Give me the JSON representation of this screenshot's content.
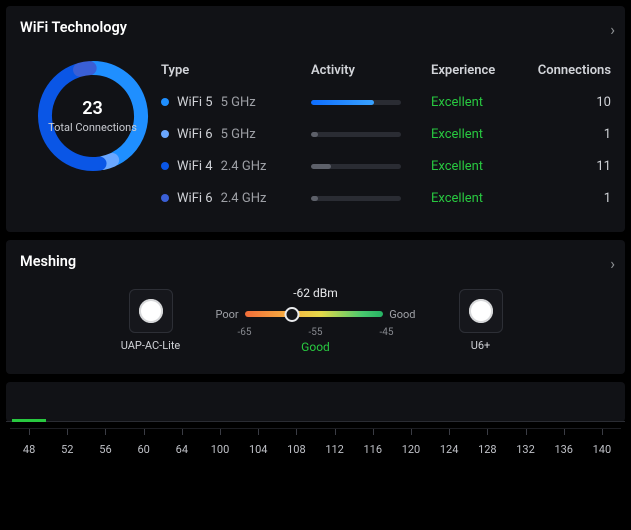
{
  "wifi": {
    "title": "WiFi Technology",
    "total": "23",
    "total_label": "Total Connections",
    "columns": {
      "type": "Type",
      "activity": "Activity",
      "experience": "Experience",
      "connections": "Connections"
    },
    "rows": [
      {
        "type": "WiFi 5",
        "band": "5 GHz",
        "color": "#1f8fff",
        "activity": 0.7,
        "fill": "linear-gradient(to right,#0d6dff,#39a2ff)",
        "experience": "Excellent",
        "connections": "10"
      },
      {
        "type": "WiFi 6",
        "band": "5 GHz",
        "color": "#6aa7ff",
        "activity": 0.08,
        "fill": "#5d6069",
        "experience": "Excellent",
        "connections": "1"
      },
      {
        "type": "WiFi 4",
        "band": "2.4 GHz",
        "color": "#0a56e6",
        "activity": 0.22,
        "fill": "#5d6069",
        "experience": "Excellent",
        "connections": "11"
      },
      {
        "type": "WiFi 6",
        "band": "2.4 GHz",
        "color": "#3a5fd6",
        "activity": 0.08,
        "fill": "#5d6069",
        "experience": "Excellent",
        "connections": "1"
      }
    ]
  },
  "chart_data": {
    "type": "pie",
    "title": "WiFi Technology — Total Connections",
    "categories": [
      "WiFi 5 · 5 GHz",
      "WiFi 6 · 5 GHz",
      "WiFi 4 · 2.4 GHz",
      "WiFi 6 · 2.4 GHz"
    ],
    "values": [
      10,
      1,
      11,
      1
    ],
    "colors": [
      "#1f8fff",
      "#6aa7ff",
      "#0a56e6",
      "#3a5fd6"
    ],
    "total": 23
  },
  "mesh": {
    "title": "Meshing",
    "left_device": "UAP-AC-Lite",
    "right_device": "U6+",
    "value": "-62 dBm",
    "scale": {
      "poor": "Poor",
      "good": "Good",
      "t1": "-65",
      "t2": "-55",
      "t3": "-45"
    },
    "status": "Good",
    "pos_pct": 34
  },
  "timeline": {
    "values": [
      "48",
      "52",
      "56",
      "60",
      "64",
      "100",
      "104",
      "108",
      "112",
      "116",
      "120",
      "124",
      "128",
      "132",
      "136",
      "140"
    ]
  }
}
